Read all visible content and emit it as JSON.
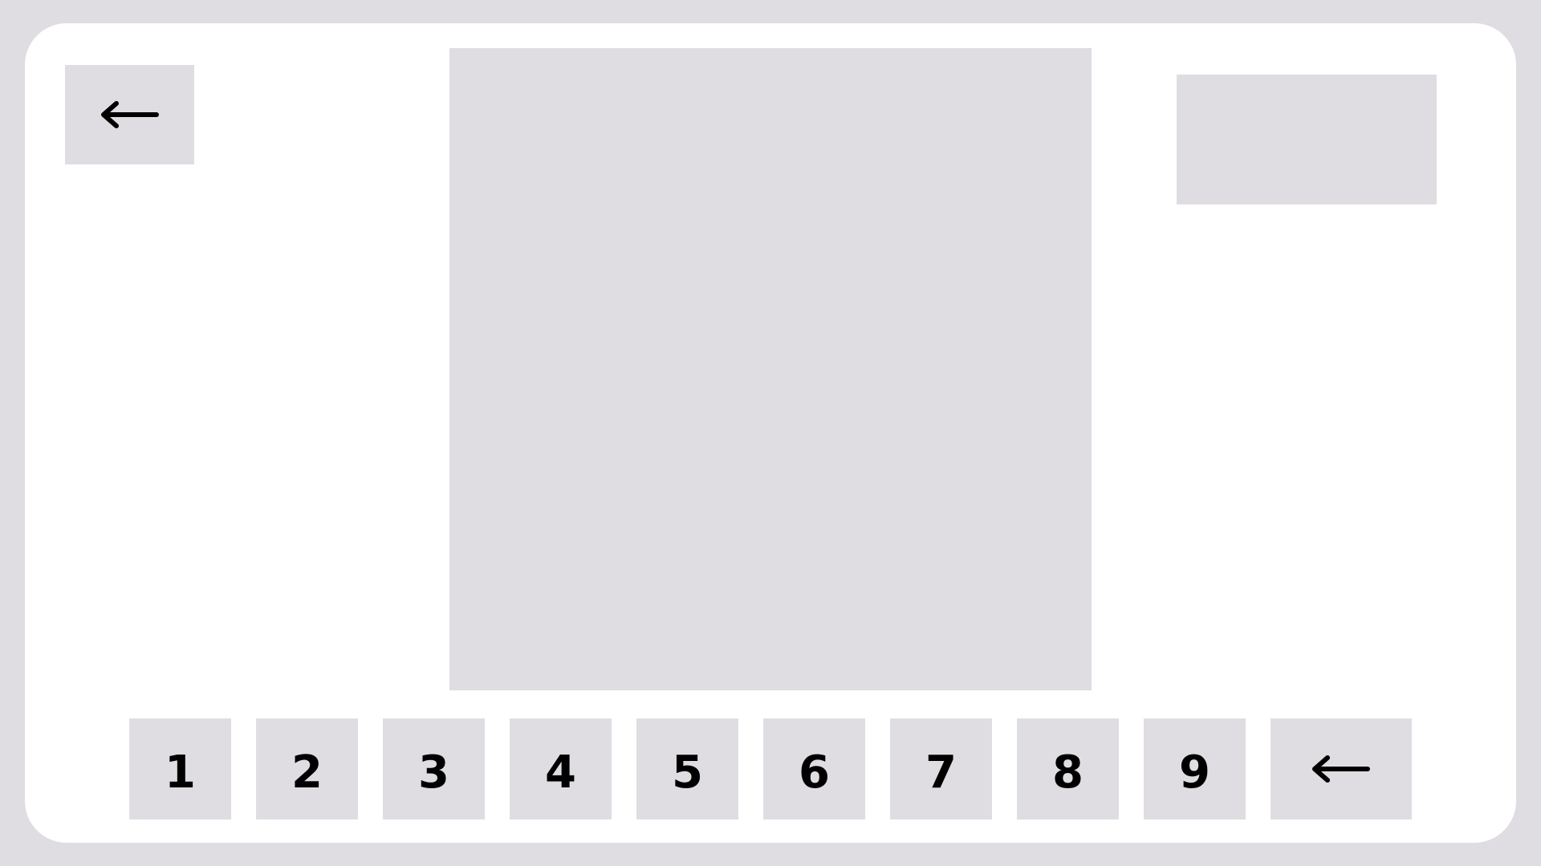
{
  "header": {
    "back_icon": "arrow-left-icon"
  },
  "keypad": {
    "keys": [
      "1",
      "2",
      "3",
      "4",
      "5",
      "6",
      "7",
      "8",
      "9"
    ],
    "backspace_icon": "arrow-left-icon"
  },
  "colors": {
    "background": "#dfdde1",
    "panel": "#ffffff",
    "tile": "#dfdde1",
    "glyph": "#000000"
  }
}
